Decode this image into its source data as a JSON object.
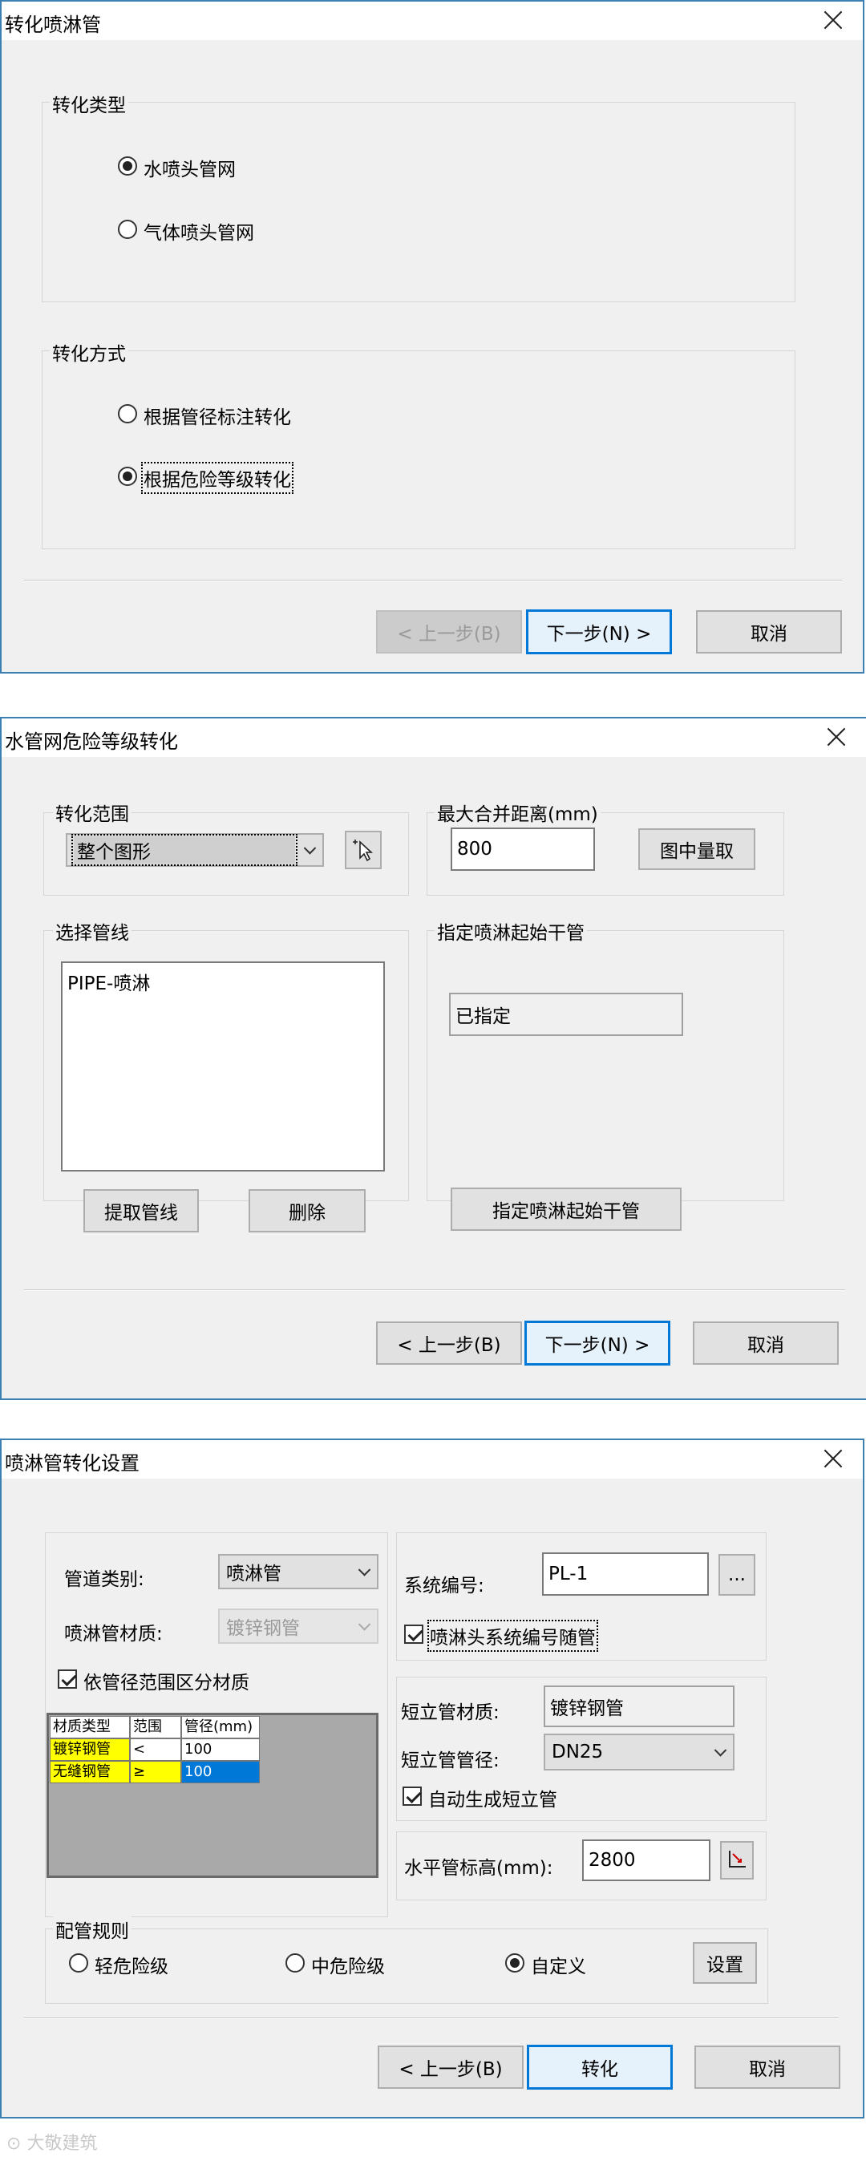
{
  "dialog1": {
    "title": "转化喷淋管",
    "group_type": {
      "legend": "转化类型",
      "options": [
        {
          "label": "水喷头管网",
          "checked": true
        },
        {
          "label": "气体喷头管网",
          "checked": false
        }
      ]
    },
    "group_mode": {
      "legend": "转化方式",
      "options": [
        {
          "label": "根据管径标注转化",
          "checked": false
        },
        {
          "label": "根据危险等级转化",
          "checked": true
        }
      ]
    },
    "buttons": {
      "prev": "< 上一步(B)",
      "next": "下一步(N) >",
      "cancel": "取消"
    }
  },
  "dialog2": {
    "title": "水管网危险等级转化",
    "range": {
      "legend": "转化范围",
      "selected": "整个图形"
    },
    "merge": {
      "legend": "最大合并距离(mm)",
      "value": "800",
      "pick_button": "图中量取"
    },
    "pipes": {
      "legend": "选择管线",
      "items": [
        "PIPE-喷淋"
      ],
      "extract_button": "提取管线",
      "delete_button": "删除"
    },
    "start_pipe": {
      "legend": "指定喷淋起始干管",
      "status": "已指定",
      "button": "指定喷淋起始干管"
    },
    "buttons": {
      "prev": "< 上一步(B)",
      "next": "下一步(N) >",
      "cancel": "取消"
    }
  },
  "dialog3": {
    "title": "喷淋管转化设置",
    "pipe_category": {
      "label": "管道类别:",
      "value": "喷淋管"
    },
    "pipe_material": {
      "label": "喷淋管材质:",
      "value": "镀锌钢管"
    },
    "split_by_diameter": {
      "label": "依管径范围区分材质",
      "checked": true
    },
    "material_table": {
      "headers": [
        "材质类型",
        "范围",
        "管径(mm)"
      ],
      "rows": [
        {
          "material": "镀锌钢管",
          "range": "<",
          "diameter": "100"
        },
        {
          "material": "无缝钢管",
          "range": "≥",
          "diameter": "100"
        }
      ]
    },
    "system_no": {
      "label": "系统编号:",
      "value": "PL-1",
      "browse": "..."
    },
    "follow_system_no": {
      "label": "喷淋头系统编号随管",
      "checked": true
    },
    "short_pipe_material": {
      "label": "短立管材质:",
      "value": "镀锌钢管"
    },
    "short_pipe_diameter": {
      "label": "短立管管径:",
      "value": "DN25"
    },
    "auto_short_pipe": {
      "label": "自动生成短立管",
      "checked": true
    },
    "horizontal_elev": {
      "label": "水平管标高(mm):",
      "value": "2800"
    },
    "rule": {
      "legend": "配管规则",
      "options": [
        {
          "label": "轻危险级",
          "checked": false
        },
        {
          "label": "中危险级",
          "checked": false
        },
        {
          "label": "自定义",
          "checked": true
        }
      ],
      "settings_button": "设置"
    },
    "buttons": {
      "prev": "< 上一步(B)",
      "next": "转化",
      "cancel": "取消"
    }
  },
  "colors": {
    "accent": "#0078d7",
    "border": "#3c7fb1",
    "highlight_yellow": "#ffff00",
    "selection_blue": "#0078d7"
  },
  "watermark": "大敬建筑"
}
